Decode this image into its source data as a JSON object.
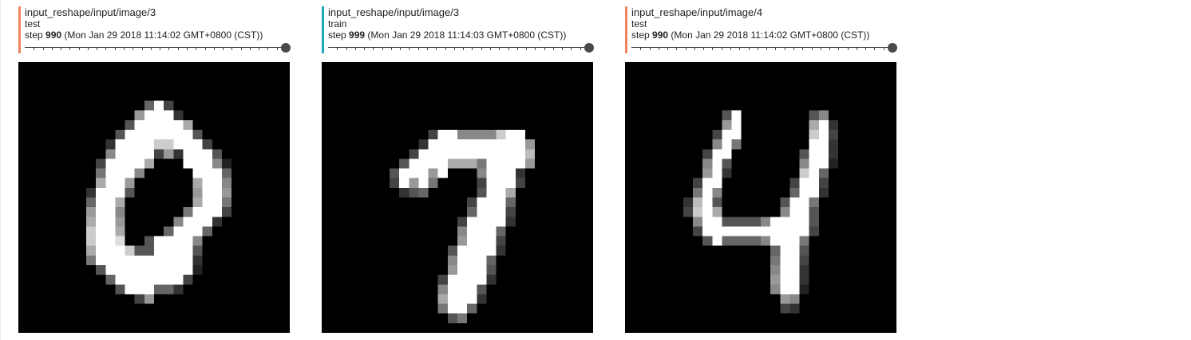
{
  "colors": {
    "test_run": "#f0825f",
    "train_run": "#18a8b9"
  },
  "cards": [
    {
      "tag": "input_reshape/input/image/3",
      "run": "test",
      "step_prefix": "step",
      "step": "990",
      "timestamp": "(Mon Jan 29 2018 11:14:02 GMT+0800 (CST))",
      "slider_value_fraction": 1.0,
      "image_digit": "0"
    },
    {
      "tag": "input_reshape/input/image/3",
      "run": "train",
      "step_prefix": "step",
      "step": "999",
      "timestamp": "(Mon Jan 29 2018 11:14:03 GMT+0800 (CST))",
      "slider_value_fraction": 1.0,
      "image_digit": "7"
    },
    {
      "tag": "input_reshape/input/image/4",
      "run": "test",
      "step_prefix": "step",
      "step": "990",
      "timestamp": "(Mon Jan 29 2018 11:14:02 GMT+0800 (CST))",
      "slider_value_fraction": 1.0,
      "image_digit": "4"
    }
  ]
}
